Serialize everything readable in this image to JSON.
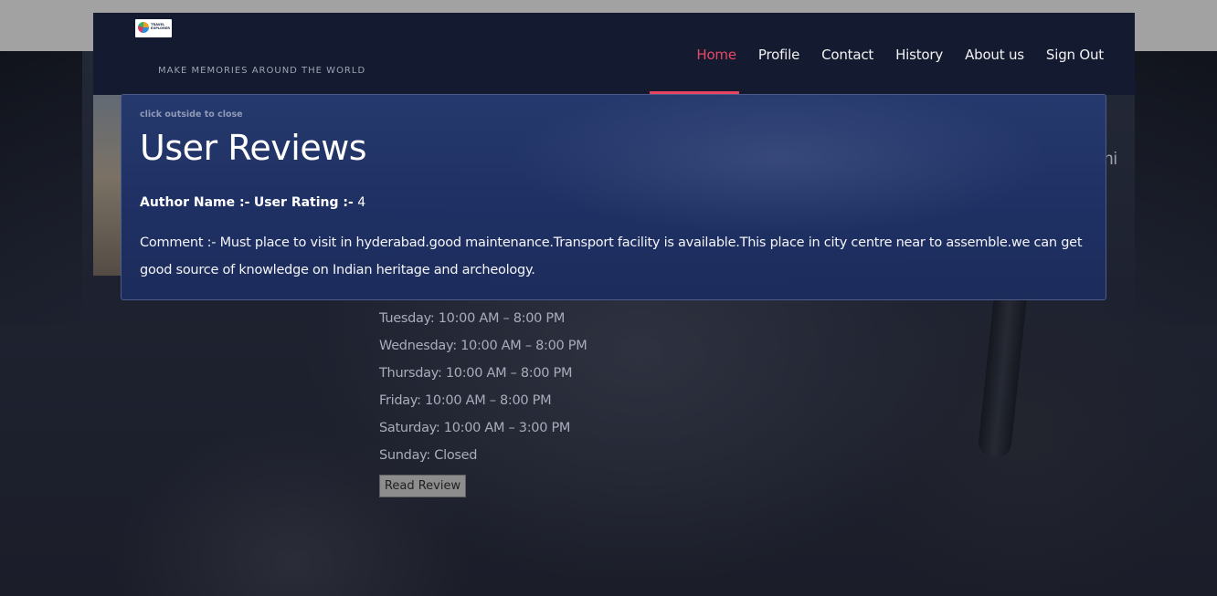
{
  "header": {
    "logo_text": "TRAVEL\nEXPLORER",
    "tagline": "MAKE MEMORIES AROUND THE WORLD",
    "nav": [
      {
        "label": "Home",
        "active": true
      },
      {
        "label": "Profile",
        "active": false
      },
      {
        "label": "Contact",
        "active": false
      },
      {
        "label": "History",
        "active": false
      },
      {
        "label": "About us",
        "active": false
      },
      {
        "label": "Sign Out",
        "active": false
      }
    ],
    "accent_color": "#e84a65"
  },
  "background": {
    "partial_text": "ni",
    "hours": [
      "Tuesday: 10:00 AM – 8:00 PM",
      "Wednesday: 10:00 AM – 8:00 PM",
      "Thursday: 10:00 AM – 8:00 PM",
      "Friday: 10:00 AM – 8:00 PM",
      "Saturday: 10:00 AM – 3:00 PM",
      "Sunday: Closed"
    ],
    "read_review_label": "Read Review"
  },
  "modal": {
    "close_hint": "click outside to close",
    "title": "User Reviews",
    "author_label": "Author Name :-",
    "author_name": "",
    "rating_label": "User Rating :-",
    "rating_value": "4",
    "comment": "Comment :- Must place to visit in hyderabad.good maintenance.Transport facility is available.This place in city centre near to assemble.we can get good source of knowledge on Indian heritage and archeology."
  }
}
